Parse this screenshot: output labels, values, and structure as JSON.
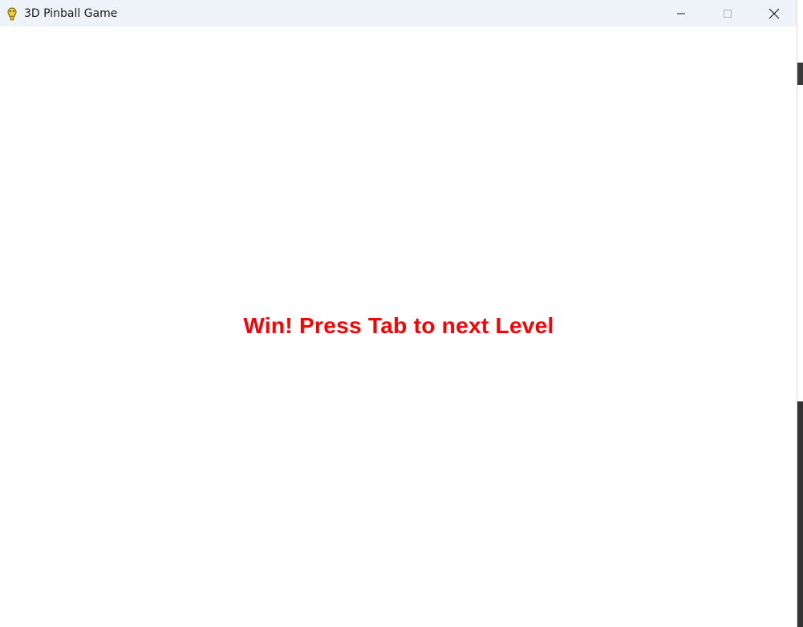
{
  "window": {
    "title": "3D Pinball Game",
    "icon": "pygame-snake-icon",
    "controls": {
      "minimize": "minimize-icon",
      "maximize": "maximize-icon",
      "close": "close-icon"
    }
  },
  "game": {
    "message": "Win! Press Tab to next Level",
    "message_color": "#ff0000",
    "background_color": "#ffffff"
  }
}
